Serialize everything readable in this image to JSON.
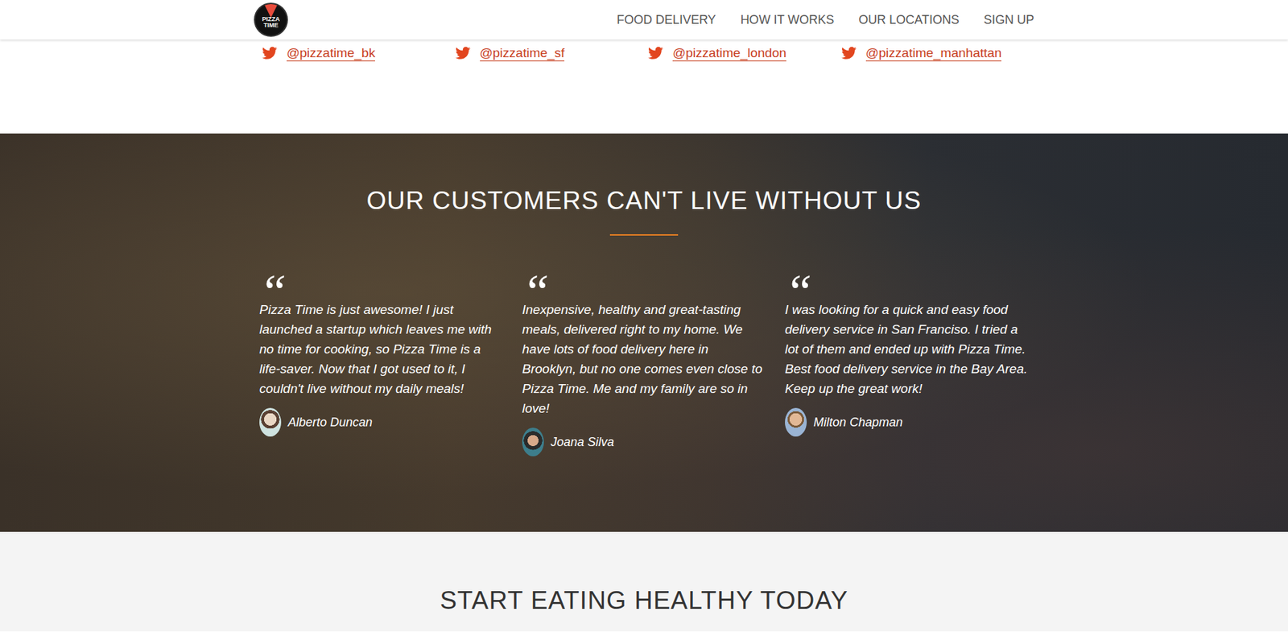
{
  "nav": {
    "logo": [
      "PIZZA",
      "TIME"
    ],
    "links": [
      "FOOD DELIVERY",
      "HOW IT WORKS",
      "OUR LOCATIONS",
      "SIGN UP"
    ]
  },
  "twitter": [
    "@pizzatime_bk",
    "@pizzatime_sf",
    "@pizzatime_london",
    "@pizzatime_manhattan"
  ],
  "testimonials": {
    "title": "OUR CUSTOMERS CAN'T LIVE WITHOUT US",
    "quote_mark": "“",
    "items": [
      {
        "text": "Pizza Time is just awesome! I just launched a startup which leaves me with no time for cooking, so Pizza Time is a life-saver. Now that I got used to it, I couldn't live without my daily meals!",
        "name": "Alberto Duncan"
      },
      {
        "text": "Inexpensive, healthy and great-tasting meals, delivered right to my home. We have lots of food delivery here in Brooklyn, but no one comes even close to Pizza Time. Me and my family are so in love!",
        "name": "Joana Silva"
      },
      {
        "text": "I was looking for a quick and easy food delivery service in San Franciso. I tried a lot of them and ended up with Pizza Time. Best food delivery service in the Bay Area. Keep up the great work!",
        "name": "Milton Chapman"
      }
    ]
  },
  "cta": {
    "title": "START EATING HEALTHY TODAY"
  }
}
